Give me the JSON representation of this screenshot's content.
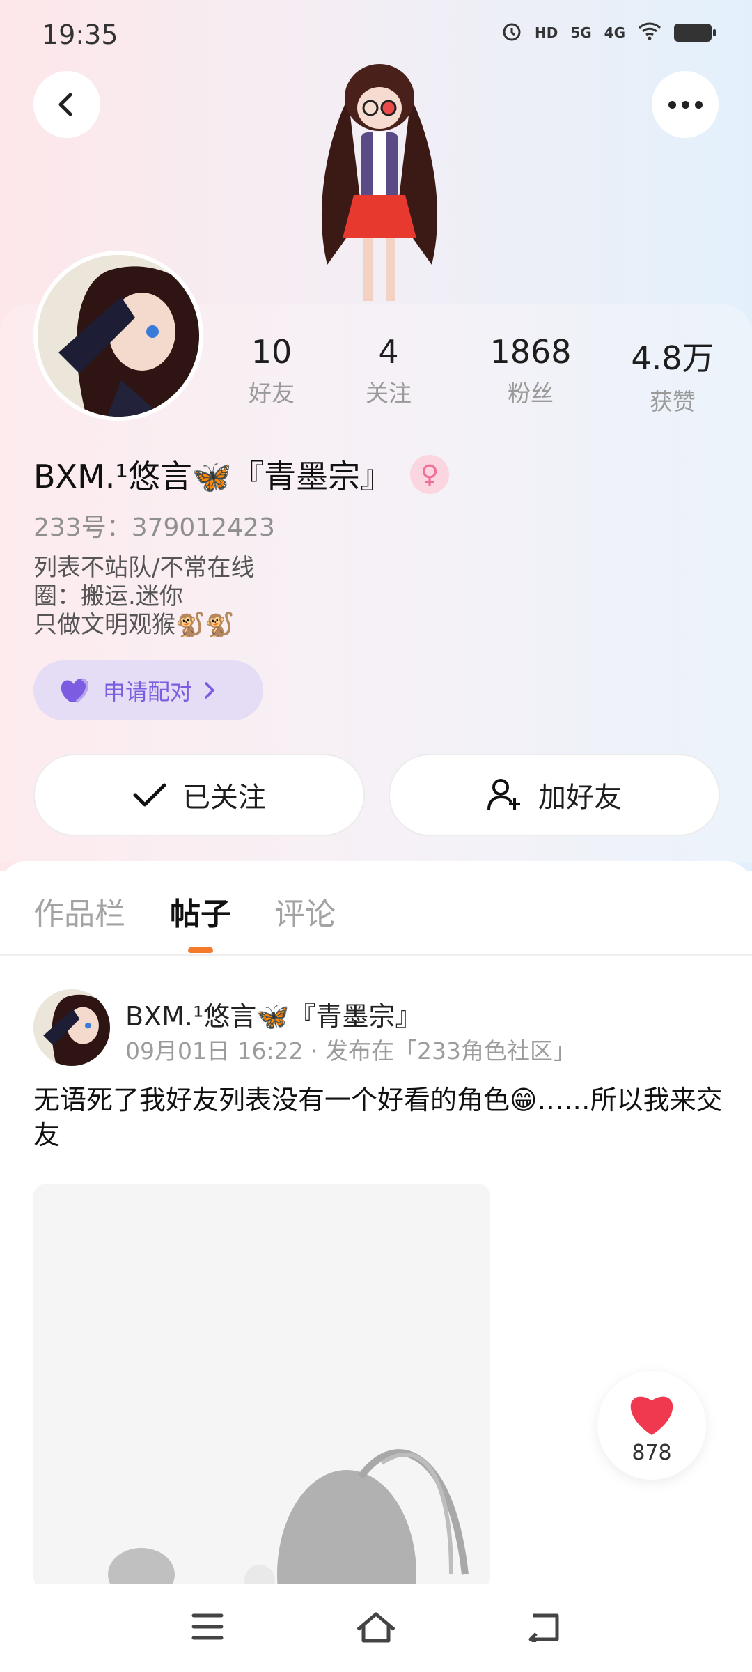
{
  "status_bar": {
    "time": "19:35",
    "icons": [
      "alarm-icon",
      "hd-icon",
      "5g-signal-icon",
      "4g-signal-icon",
      "wifi-icon",
      "battery-icon"
    ],
    "hd": "HD",
    "net5g": "5G",
    "net4g": "4G"
  },
  "header": {
    "back_icon": "chevron-left-icon",
    "more_icon": "more-icon"
  },
  "profile": {
    "stats": [
      {
        "value": "10",
        "label": "好友"
      },
      {
        "value": "4",
        "label": "关注"
      },
      {
        "value": "1868",
        "label": "粉丝"
      },
      {
        "value": "4.8万",
        "label": "获赞"
      }
    ],
    "nickname": "BXM.¹悠言🦋『青墨宗』",
    "gender_icon": "♀",
    "uid": "233号：379012423",
    "bio_lines": [
      "列表不站队/不常在线",
      "圈：搬运.迷你",
      "只做文明观猴🐒🐒"
    ],
    "pair_label": "申请配对",
    "follow_label": "已关注",
    "add_friend_label": "加好友"
  },
  "tabs": [
    {
      "label": "作品栏",
      "active": false
    },
    {
      "label": "帖子",
      "active": true
    },
    {
      "label": "评论",
      "active": false
    }
  ],
  "post": {
    "author": "BXM.¹悠言🦋『青墨宗』",
    "meta": "09月01日 16:22 · 发布在「233角色社区」",
    "text": "无语死了我好友列表没有一个好看的角色😁……所以我来交友"
  },
  "like": {
    "count": "878"
  },
  "nav": {
    "icons": [
      "menu-icon",
      "home-icon",
      "back-nav-icon"
    ]
  },
  "colors": {
    "accent": "#f47a2a",
    "pair_purple": "#7c5ce0",
    "like_red": "#f0394e"
  }
}
